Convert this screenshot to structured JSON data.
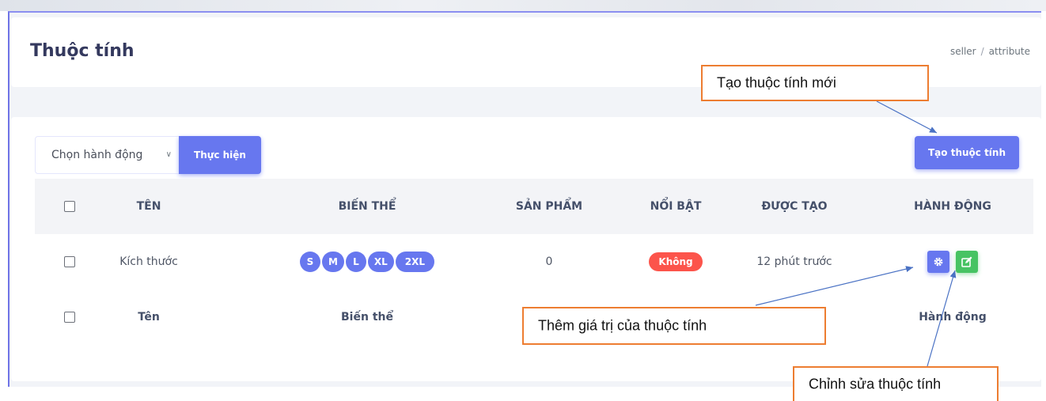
{
  "header": {
    "title": "Thuộc tính",
    "breadcrumb": [
      "seller",
      "attribute"
    ]
  },
  "toolbar": {
    "action_select_value": "Chọn hành động",
    "run_label": "Thực hiện",
    "create_label": "Tạo thuộc tính"
  },
  "table": {
    "headers": [
      "TÊN",
      "BIẾN THỂ",
      "SẢN PHẨM",
      "NỔI BẬT",
      "ĐƯỢC TẠO",
      "HÀNH ĐỘNG"
    ],
    "footers": [
      "Tên",
      "Biến thể",
      "Hành động"
    ],
    "rows": [
      {
        "name": "Kích thước",
        "variants": [
          "S",
          "M",
          "L",
          "XL",
          "2XL"
        ],
        "products": "0",
        "featured": "Không",
        "created": "12 phút trước"
      }
    ]
  },
  "annotations": {
    "create_new": "Tạo thuộc tính mới",
    "add_value": "Thêm giá trị của thuộc tính",
    "edit": "Chỉnh sửa thuộc tính"
  },
  "colors": {
    "primary": "#6777ef",
    "success": "#47c363",
    "danger": "#fc544b",
    "callout_border": "#ed7d31"
  }
}
